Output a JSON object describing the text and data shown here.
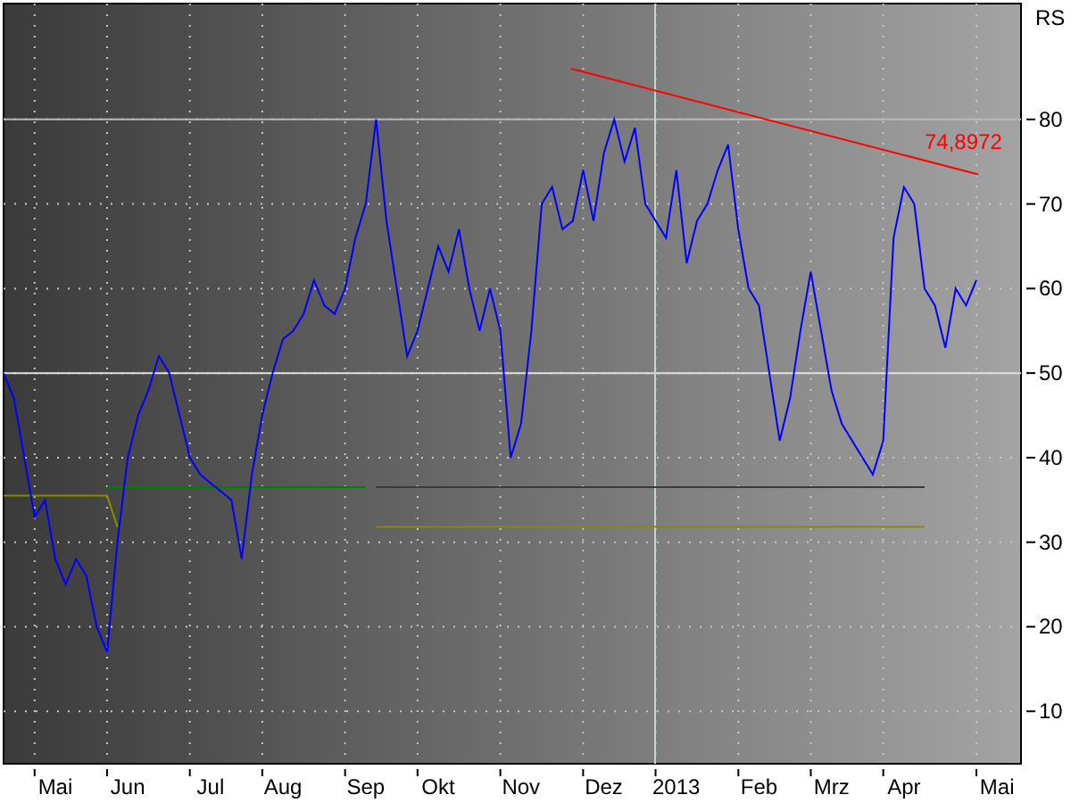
{
  "chart": {
    "chart_data": {
      "type": "line",
      "title": "RS",
      "grid": true,
      "categories": [
        null,
        null,
        null,
        null,
        null,
        "Mai",
        null,
        null,
        null,
        null,
        null,
        null,
        "Jun",
        null,
        null,
        null,
        null,
        null,
        null,
        null,
        "Jul",
        null,
        null,
        null,
        null,
        null,
        null,
        "Aug",
        null,
        null,
        null,
        null,
        null,
        null,
        null,
        "Sep",
        null,
        null,
        null,
        null,
        null,
        null,
        "Okt",
        null,
        null,
        null,
        null,
        null,
        null,
        null,
        "Nov",
        null,
        null,
        null,
        null,
        null,
        null,
        null,
        "Dez",
        null,
        null,
        null,
        null,
        null,
        null,
        "2013",
        null,
        null,
        null,
        null,
        null,
        null,
        null,
        "Feb",
        null,
        null,
        null,
        null,
        null,
        null,
        "Mrz",
        null,
        null,
        null,
        null,
        null,
        null,
        "Apr",
        null,
        null,
        null,
        null,
        null,
        null,
        null,
        null,
        "Mai"
      ],
      "series": [
        {
          "color": "#8a8a00",
          "values": [
            35.5,
            35.5,
            35.5,
            35.5,
            35.5,
            35.5,
            35.5,
            35.5,
            35.5,
            35.5,
            35.5,
            31.8,
            null,
            null,
            null,
            null,
            null,
            null,
            null,
            null,
            null,
            null,
            null,
            null,
            null,
            null,
            null,
            null,
            null,
            null,
            null,
            null,
            null,
            null,
            null,
            null,
            31.8,
            31.8,
            31.8,
            31.8,
            31.8,
            31.8,
            31.8,
            31.8,
            31.8,
            31.8,
            31.8,
            31.8,
            31.8,
            31.8,
            31.8,
            31.8,
            31.8,
            31.8,
            31.8,
            31.8,
            31.8,
            31.8,
            31.8,
            31.8,
            31.8,
            31.8,
            31.8,
            31.8,
            31.8,
            31.8,
            31.8,
            31.8,
            31.8,
            31.8,
            31.8,
            31.8,
            31.8,
            31.8,
            31.8,
            31.8,
            31.8,
            31.8,
            31.8,
            31.8,
            31.8,
            31.8,
            31.8,
            31.8,
            31.8,
            31.8,
            31.8,
            31.8,
            31.8,
            31.8,
            null,
            null,
            null,
            null,
            null,
            null,
            null
          ]
        },
        {
          "color": "#008000",
          "values": [
            null,
            null,
            null,
            null,
            null,
            null,
            null,
            null,
            null,
            null,
            36.5,
            36.5,
            36.5,
            36.5,
            36.5,
            36.5,
            36.5,
            36.5,
            36.5,
            36.5,
            36.5,
            36.5,
            36.5,
            36.5,
            36.5,
            36.5,
            36.5,
            36.5,
            36.5,
            36.5,
            36.5,
            36.5,
            36.5,
            36.5,
            36.5,
            36.5,
            null,
            null,
            null,
            null,
            null,
            null,
            null,
            null,
            null,
            null,
            null,
            null,
            null,
            null,
            null,
            null,
            null,
            null,
            null,
            null,
            null,
            null,
            null,
            null,
            null,
            null,
            null,
            null,
            null,
            null,
            null,
            null,
            null,
            null,
            null,
            null,
            null,
            null,
            null,
            null,
            null,
            null,
            null,
            null,
            null,
            null,
            null,
            null,
            null,
            null,
            null,
            null,
            null,
            null,
            null,
            null,
            null,
            null,
            null,
            null,
            null
          ]
        },
        {
          "color": "#3a3a3a",
          "values": [
            null,
            null,
            null,
            null,
            null,
            null,
            null,
            null,
            null,
            null,
            null,
            null,
            null,
            null,
            null,
            null,
            null,
            null,
            null,
            null,
            null,
            null,
            null,
            null,
            null,
            null,
            null,
            null,
            null,
            null,
            null,
            null,
            null,
            null,
            null,
            null,
            36.5,
            36.5,
            36.5,
            36.5,
            36.5,
            36.5,
            36.5,
            36.5,
            36.5,
            36.5,
            36.5,
            36.5,
            36.5,
            36.5,
            36.5,
            36.5,
            36.5,
            36.5,
            36.5,
            36.5,
            36.5,
            36.5,
            36.5,
            36.5,
            36.5,
            36.5,
            36.5,
            36.5,
            36.5,
            36.5,
            36.5,
            36.5,
            36.5,
            36.5,
            36.5,
            36.5,
            36.5,
            36.5,
            36.5,
            36.5,
            36.5,
            36.5,
            36.5,
            36.5,
            36.5,
            36.5,
            36.5,
            36.5,
            36.5,
            36.5,
            36.5,
            36.5,
            36.5,
            36.5,
            null,
            null,
            null,
            null,
            null,
            null,
            null
          ]
        },
        {
          "color": "#0000ff",
          "values": [
            50,
            47,
            40,
            33,
            35,
            28,
            25,
            28,
            26,
            20,
            17,
            30,
            40,
            45,
            48,
            52,
            50,
            45,
            40,
            38,
            37,
            36,
            35,
            28,
            38,
            45,
            50,
            54,
            55,
            57,
            61,
            58,
            57,
            60,
            66,
            70,
            80,
            68,
            60,
            52,
            55,
            60,
            65,
            62,
            67,
            60,
            55,
            60,
            55,
            40,
            44,
            55,
            70,
            72,
            67,
            68,
            74,
            68,
            76,
            80,
            75,
            79,
            70,
            68,
            66,
            74,
            63,
            68,
            70,
            74,
            77,
            67,
            60,
            58,
            50,
            42,
            47,
            55,
            62,
            55,
            48,
            44,
            42,
            40,
            38,
            42,
            66,
            72,
            70,
            60,
            58,
            53,
            60,
            58,
            61,
            null,
            null
          ]
        }
      ],
      "ylim": [
        3.8,
        93.7
      ],
      "yticks": [
        10,
        20,
        30,
        40,
        50,
        60,
        70,
        80
      ],
      "ref_lines": [
        {
          "axis": "y",
          "value": 50,
          "color": "#e0e0e0"
        },
        {
          "axis": "y",
          "value": 80,
          "color": "#b8b8b8"
        }
      ]
    },
    "trendline_label": "74,8972"
  }
}
